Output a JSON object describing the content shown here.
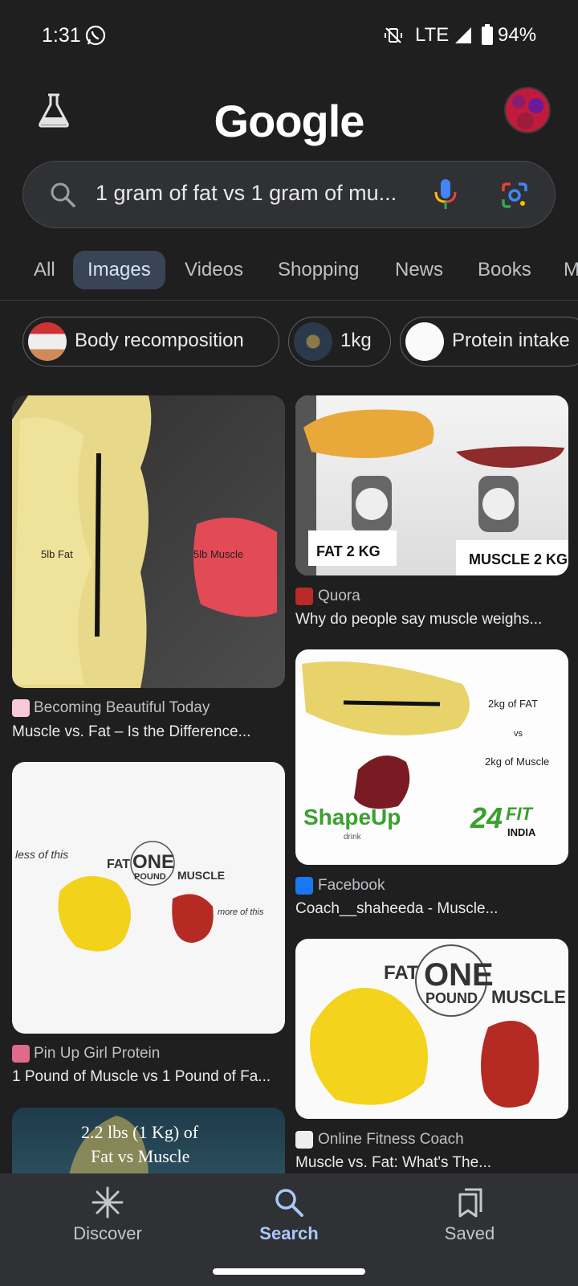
{
  "status_bar": {
    "time": "1:31",
    "network": "LTE",
    "battery": "94%"
  },
  "header": {
    "logo": "Google"
  },
  "search": {
    "query": "1 gram of fat vs 1 gram of mu..."
  },
  "tabs": [
    "All",
    "Images",
    "Videos",
    "Shopping",
    "News",
    "Books",
    "M"
  ],
  "chips": [
    "Body recomposition",
    "1kg",
    "Protein intake"
  ],
  "results": {
    "r1": {
      "source": "Becoming Beautiful Today",
      "title": "Muscle vs. Fat – Is the Difference...",
      "img_labels": [
        "5lb Fat",
        "5lb Muscle"
      ]
    },
    "r2": {
      "source": "Quora",
      "title": "Why do people say muscle weighs...",
      "img_labels": [
        "FAT 2 KG",
        "MUSCLE 2 KG"
      ]
    },
    "r3": {
      "source": "Facebook",
      "title": "Coach__shaheeda - Muscle...",
      "img_labels": [
        "2kg of FAT",
        "vs",
        "2kg of Muscle",
        "ShapeUp",
        "drink",
        "24",
        "FIT",
        "INDIA"
      ]
    },
    "r4": {
      "source": "Pin Up Girl Protein",
      "title": "1 Pound of Muscle vs 1 Pound of Fa...",
      "img_labels": [
        "less of this",
        "FAT",
        "ONE",
        "POUND",
        "MUSCLE",
        "more of this"
      ]
    },
    "r5": {
      "source": "Online Fitness Coach",
      "title": "Muscle vs. Fat: What's The...",
      "img_labels": [
        "FAT",
        "ONE",
        "POUND",
        "MUSCLE"
      ]
    },
    "r6": {
      "img_labels": [
        "2.2 lbs (1 Kg) of",
        "Fat vs Muscle"
      ]
    }
  },
  "bottom_nav": [
    "Discover",
    "Search",
    "Saved"
  ]
}
